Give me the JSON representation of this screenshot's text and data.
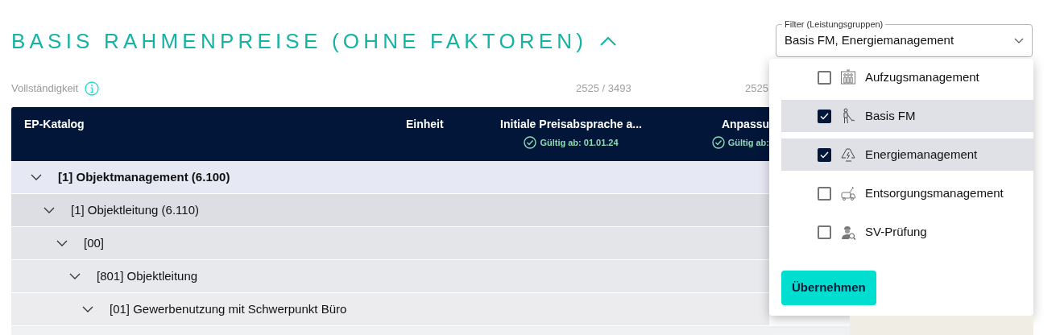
{
  "section": {
    "title": "BASIS RAHMENPREISE (OHNE FAKTOREN)",
    "expanded": true
  },
  "completeness": {
    "label": "Vollständigkeit",
    "values": [
      "2525 / 3493",
      "2525"
    ]
  },
  "table": {
    "columns": [
      {
        "label": "EP-Katalog"
      },
      {
        "label": "Einheit"
      },
      {
        "label": "Initiale Preisabsprache a...",
        "valid": "Gültig ab: 01.01.24"
      },
      {
        "label": "Anpassu",
        "valid": "Gültig ab:"
      }
    ],
    "rows": [
      {
        "label": "[1] Objektmanagement (6.100)",
        "expanded": true,
        "children": [
          {
            "label": "[1] Objektleitung (6.110)",
            "expanded": true,
            "children": [
              {
                "label": "[00]",
                "expanded": true,
                "children": [
                  {
                    "label": "[801] Objektleitung",
                    "expanded": true,
                    "children": [
                      {
                        "label": "[01] Gewerbenutzung mit Schwerpunkt Büro",
                        "expanded": true
                      }
                    ]
                  }
                ]
              }
            ]
          }
        ]
      }
    ]
  },
  "filter": {
    "label": "Filter (Leistungsgruppen)",
    "value": "Basis FM, Energiemanagement",
    "options": [
      {
        "label": "Aufzugsmanagement",
        "checked": false
      },
      {
        "label": "Basis FM",
        "checked": true
      },
      {
        "label": "Energiemanagement",
        "checked": true
      },
      {
        "label": "Entsorgungsmanagement",
        "checked": false
      },
      {
        "label": "SV-Prüfung",
        "checked": false
      }
    ],
    "button": "Übernehmen"
  }
}
